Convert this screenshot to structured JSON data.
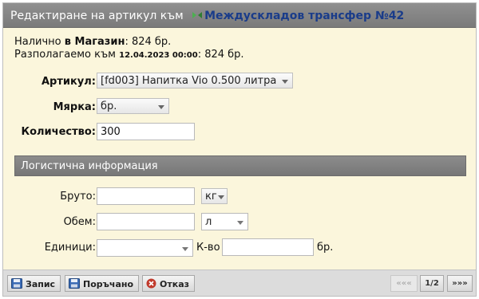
{
  "dialog": {
    "title_prefix": "Редактиране на артикул към",
    "title_link": "Междускладов трансфер №42"
  },
  "info": {
    "available_prefix": "Налично",
    "available_location": "в Магазин",
    "available_value": ": 824 бр.",
    "disposable_prefix": "Разполагаемо към",
    "disposable_date": "12.04.2023 00:00",
    "disposable_value": ": 824 бр."
  },
  "form": {
    "article_label": "Артикул",
    "article_value": "[fd003] Напитка Vio 0.500 литра",
    "measure_label": "Мярка",
    "measure_value": "бр.",
    "quantity_label": "Количество",
    "quantity_value": "300"
  },
  "logistics": {
    "section_title": "Логистична информация",
    "gross_label": "Бруто:",
    "gross_value": "",
    "gross_unit": "кг",
    "volume_label": "Обем:",
    "volume_value": "",
    "volume_unit": "л",
    "units_label": "Единици:",
    "units_value": "",
    "qty_label": "К-во",
    "qty_value": "",
    "qty_unit": "бр."
  },
  "footer": {
    "save_label": "Запис",
    "order_label": "Поръчано",
    "cancel_label": "Отказ",
    "prev_label": "«««",
    "page_label": "1/2",
    "next_label": "»»»"
  },
  "colors": {
    "dialog_bg": "#fbf6dc",
    "title_bar": "#808080",
    "title_link": "#1a3c8a",
    "cancel_icon": "#c0392b"
  }
}
